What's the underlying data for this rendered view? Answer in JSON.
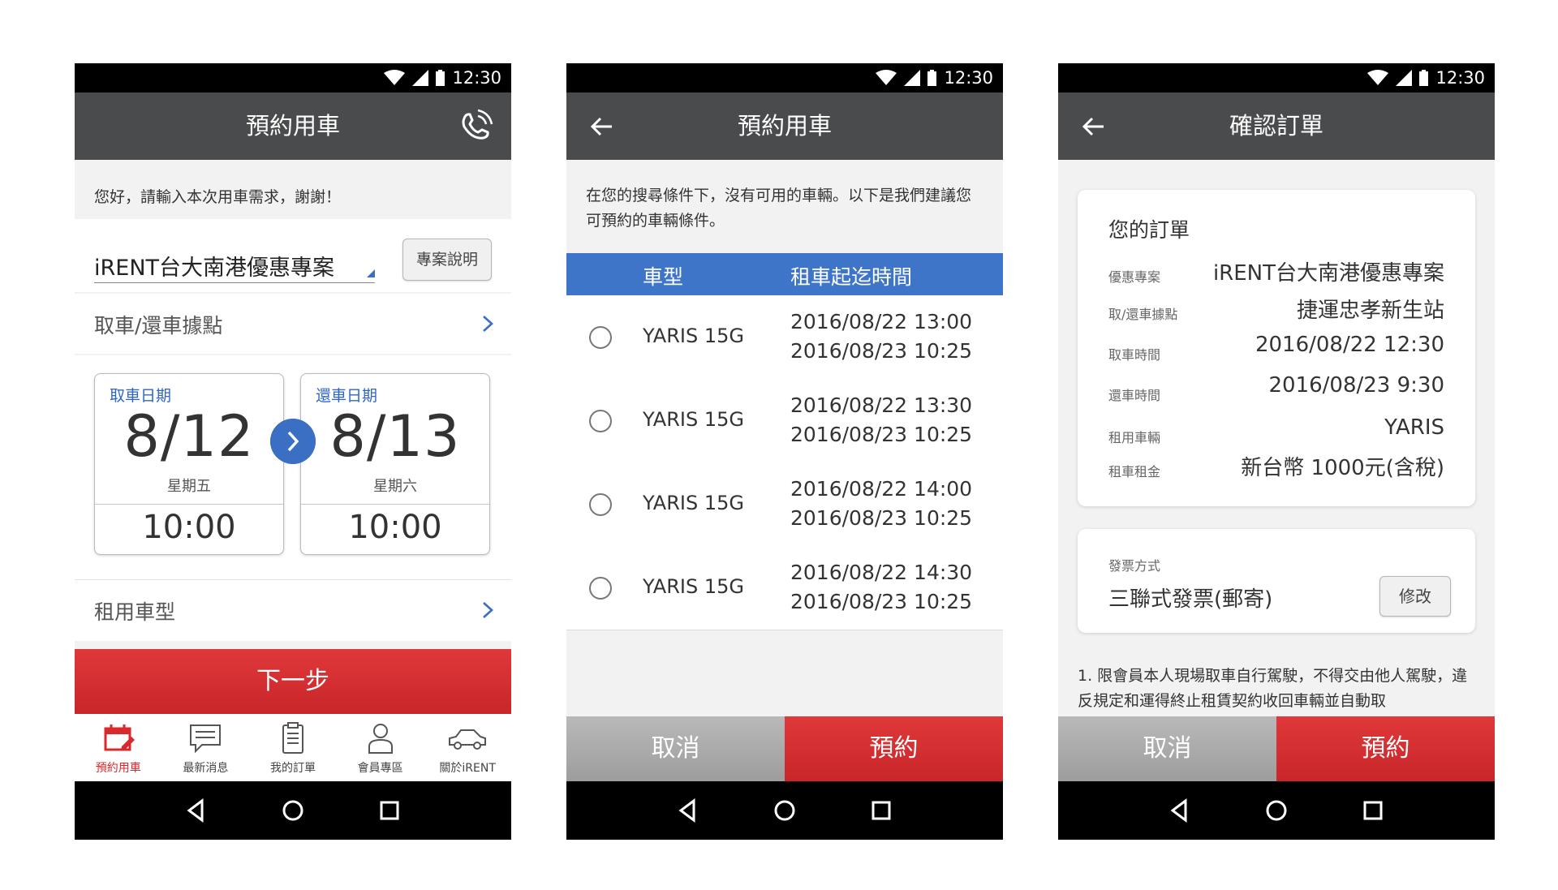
{
  "status_time": "12:30",
  "colors": {
    "appbar": "#4a4b4d",
    "accent_blue": "#3a6fc4",
    "accent_red": "#d8292d",
    "cancel_grey": "#a8a8a8"
  },
  "icons": [
    "wifi-icon",
    "signal-icon",
    "battery-icon",
    "phone-call-icon",
    "back-arrow-icon",
    "chevron-right-icon",
    "nav-back-icon",
    "nav-home-icon",
    "nav-recents-icon"
  ],
  "screen1": {
    "title": "預約用車",
    "greeting": "您好，請輸入本次用車需求，謝謝！",
    "plan": "iRENT台大南港優惠專案",
    "plan_button": "專案說明",
    "location_label": "取車/還車據點",
    "pickup": {
      "caption": "取車日期",
      "date": "8/12",
      "weekday": "星期五",
      "time": "10:00"
    },
    "return": {
      "caption": "還車日期",
      "date": "8/13",
      "weekday": "星期六",
      "time": "10:00"
    },
    "car_type_label": "租用車型",
    "next_button": "下一步",
    "tabs": [
      {
        "label": "預約用車",
        "icon": "calendar-icon",
        "active": true
      },
      {
        "label": "最新消息",
        "icon": "message-icon",
        "active": false
      },
      {
        "label": "我的訂單",
        "icon": "clipboard-icon",
        "active": false
      },
      {
        "label": "會員專區",
        "icon": "person-icon",
        "active": false
      },
      {
        "label": "關於iRENT",
        "icon": "car-icon",
        "active": false
      }
    ]
  },
  "screen2": {
    "title": "預約用車",
    "notice": "在您的搜尋條件下，沒有可用的車輛。以下是我們建議您可預約的車輛條件。",
    "header_model": "車型",
    "header_time": "租車起迄時間",
    "rows": [
      {
        "model": "YARIS 15G",
        "start": "2016/08/22 13:00",
        "end": "2016/08/23 10:25"
      },
      {
        "model": "YARIS 15G",
        "start": "2016/08/22 13:30",
        "end": "2016/08/23 10:25"
      },
      {
        "model": "YARIS 15G",
        "start": "2016/08/22 14:00",
        "end": "2016/08/23 10:25"
      },
      {
        "model": "YARIS 15G",
        "start": "2016/08/22 14:30",
        "end": "2016/08/23 10:25"
      }
    ],
    "cancel": "取消",
    "book": "預約"
  },
  "screen3": {
    "title": "確認訂單",
    "order_title": "您的訂單",
    "details": [
      {
        "label": "優惠專案",
        "value": "iRENT台大南港優惠專案"
      },
      {
        "label": "取/還車據點",
        "value": "捷運忠孝新生站"
      },
      {
        "label": "取車時間",
        "value": "2016/08/22   12:30"
      },
      {
        "label": "還車時間",
        "value": "2016/08/23    9:30"
      },
      {
        "label": "租用車輛",
        "value": "YARIS"
      },
      {
        "label": "租車租金",
        "value": "新台幣 1000元(含稅)"
      }
    ],
    "invoice_label": "發票方式",
    "invoice_value": "三聯式發票(郵寄)",
    "invoice_button": "修改",
    "terms": "1. 限會員本人現場取車自行駕駛，不得交由他人駕駛，違反規定和運得終止租賃契約收回車輛並自動取",
    "cancel": "取消",
    "book": "預約"
  }
}
